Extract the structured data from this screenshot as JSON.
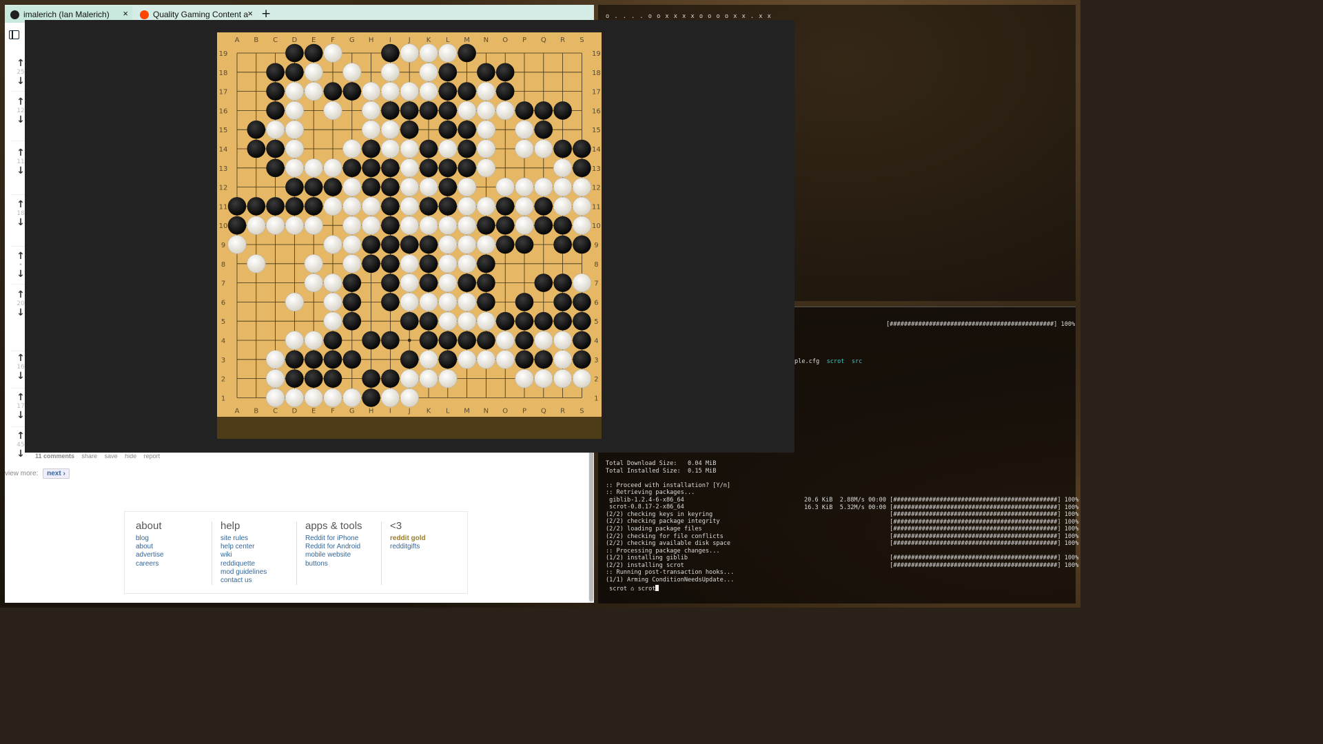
{
  "browser": {
    "tabs": [
      {
        "label": "imalerich (Ian Malerich)",
        "favicon": "github-icon"
      },
      {
        "label": "Quality Gaming Content a",
        "favicon": "reddit-icon"
      }
    ],
    "new_tab_label": "+",
    "close_label": "×",
    "vote_scores": [
      "25",
      "12",
      "11",
      "18",
      "•",
      "20",
      "16",
      "17",
      "45"
    ],
    "post_links": {
      "comments": "11 comments",
      "share": "share",
      "save": "save",
      "hide": "hide",
      "report": "report"
    },
    "view_more": {
      "label": "view more:",
      "next": "next ›"
    },
    "footer": [
      {
        "heading": "about",
        "links": [
          "blog",
          "about",
          "advertise",
          "careers"
        ]
      },
      {
        "heading": "help",
        "links": [
          "site rules",
          "help center",
          "wiki",
          "reddiquette",
          "mod guidelines",
          "contact us"
        ]
      },
      {
        "heading": "apps & tools",
        "links": [
          "Reddit for iPhone",
          "Reddit for Android",
          "mobile website",
          "buttons"
        ]
      },
      {
        "heading": "<3",
        "links": [
          "reddit gold",
          "redditgifts"
        ]
      }
    ]
  },
  "terminal_top": {
    "lines": [
      "o . . . . o o x x x x o o o o x x . x x"
    ]
  },
  "terminal_bottom": {
    "progress_top": "[##############################################] 100%",
    "ls_files": {
      "cfg": "ple.cfg",
      "dir1": "scrot",
      "dir2": "src"
    },
    "lines": [
      "Total Download Size:   0.04 MiB",
      "Total Installed Size:  0.15 MiB",
      "",
      ":: Proceed with installation? [Y/n]",
      ":: Retrieving packages...",
      " giblib-1.2.4-6-x86_64",
      " scrot-0.8.17-2-x86_64",
      "(2/2) checking keys in keyring",
      "(2/2) checking package integrity",
      "(2/2) loading package files",
      "(2/2) checking for file conflicts",
      "(2/2) checking available disk space",
      ":: Processing package changes...",
      "(1/2) installing giblib",
      "(2/2) installing scrot",
      ":: Running post-transaction hooks...",
      "(1/1) Arming ConditionNeedsUpdate..."
    ],
    "right_lines": [
      "20.6 KiB  2.88M/s 00:00 [##############################################] 100%",
      "16.3 KiB  5.32M/s 00:00 [##############################################] 100%",
      "                        [##############################################] 100%",
      "                        [##############################################] 100%",
      "                        [##############################################] 100%",
      "                        [##############################################] 100%",
      "                        [##############################################] 100%",
      "",
      "                        [##############################################] 100%",
      "                        [##############################################] 100%"
    ],
    "prompt": " scrot ⌂ scrot"
  },
  "go_board": {
    "columns": [
      "A",
      "B",
      "C",
      "D",
      "E",
      "F",
      "G",
      "H",
      "I",
      "J",
      "K",
      "L",
      "M",
      "N",
      "O",
      "P",
      "Q",
      "R",
      "S"
    ],
    "rows": [
      "19",
      "18",
      "17",
      "16",
      "15",
      "14",
      "13",
      "12",
      "11",
      "10",
      "9",
      "8",
      "7",
      "6",
      "5",
      "4",
      "3",
      "2",
      "1"
    ],
    "grid": [
      "...XXO..XOOOX......",
      "..XXO.O.O.OX.XX....",
      "..XOOXXOOOOXXOX....",
      "..XO.O.OXXXXOOOXXX.",
      ".XOO...OOX.XXO.OX..",
      ".XXO..OXOOXOXO.OOXX",
      "..XOOOXXXOXXXO...OX",
      "...XXXOXXOOXO.OOOOO",
      "XXXXXOOOXOXXOOXOXOO",
      "XOOOO.OOXOOOOXXOXXO",
      "O....OOXXXXOOOXX.XX",
      ".O..O.OXXOXOOX.....",
      "....OOX.XOXOXX..XXO",
      "...O.OX.XOOOOX.X.XX",
      ".....OX..XXOOOXXXXX",
      "...OOX.XX.XXXXOXOOX",
      "..OXXXX..XOXOOOXXOX",
      "..OXXX.XXOOO...OOOO",
      "..OOOOOXOO........."
    ]
  }
}
